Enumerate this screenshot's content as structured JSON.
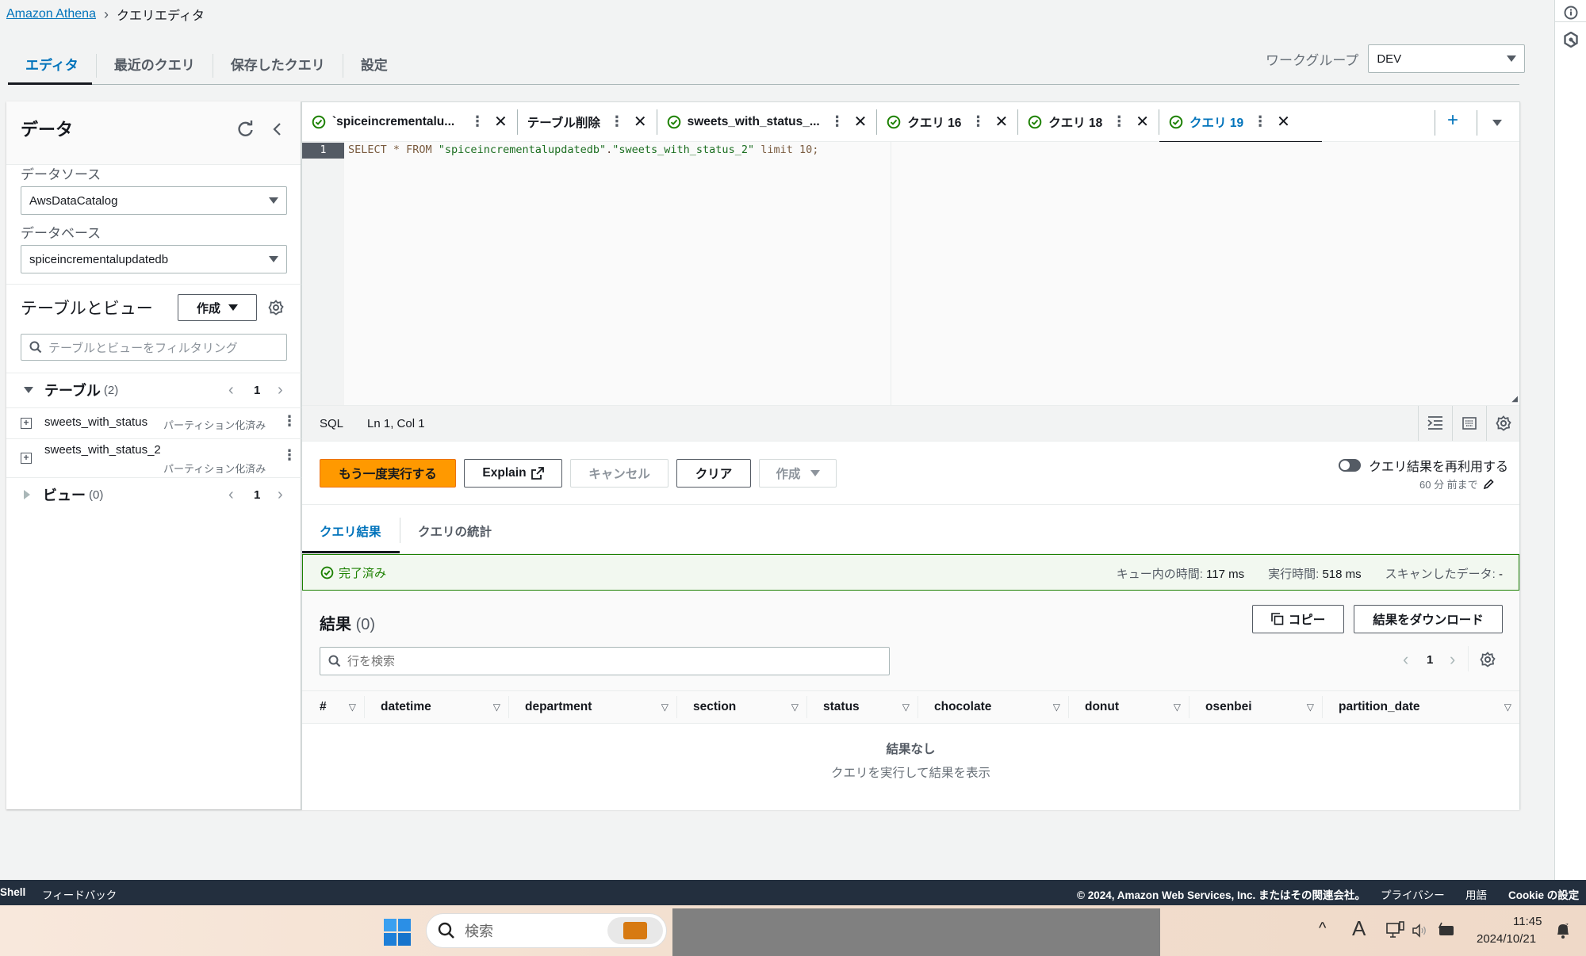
{
  "breadcrumb": {
    "root": "Amazon Athena",
    "current": "クエリエディタ"
  },
  "top_tabs": [
    {
      "label": "エディタ",
      "active": true
    },
    {
      "label": "最近のクエリ",
      "active": false
    },
    {
      "label": "保存したクエリ",
      "active": false
    },
    {
      "label": "設定",
      "active": false
    }
  ],
  "workgroup": {
    "label": "ワークグループ",
    "value": "DEV"
  },
  "left_panel": {
    "title": "データ",
    "datasource_label": "データソース",
    "datasource_value": "AwsDataCatalog",
    "database_label": "データベース",
    "database_value": "spiceincrementalupdatedb",
    "tables_views_title": "テーブルとビュー",
    "create_button": "作成",
    "filter_placeholder": "テーブルとビューをフィルタリング",
    "tables": {
      "label": "テーブル",
      "count": "(2)",
      "page": "1",
      "items": [
        {
          "name": "sweets_with_status",
          "tag": "パーティション化済み"
        },
        {
          "name": "sweets_with_status_2",
          "tag": "パーティション化済み"
        }
      ]
    },
    "views": {
      "label": "ビュー",
      "count": "(0)",
      "page": "1"
    }
  },
  "query_tabs": [
    {
      "label": "`spiceincrementalu...",
      "status": "success",
      "active": false
    },
    {
      "label": "テーブル削除",
      "status": "none",
      "active": false
    },
    {
      "label": "sweets_with_status_...",
      "status": "success",
      "active": false
    },
    {
      "label": "クエリ 16",
      "status": "success",
      "active": false
    },
    {
      "label": "クエリ 18",
      "status": "success",
      "active": false
    },
    {
      "label": "クエリ 19",
      "status": "success",
      "active": true
    }
  ],
  "editor": {
    "line_number": "1",
    "code": {
      "kw1": "SELECT * FROM ",
      "str1": "\"spiceincrementalupdatedb\"",
      "dot": ".",
      "str2": "\"sweets_with_status_2\"",
      "kw2": " limit 10;"
    },
    "language": "SQL",
    "cursor": "Ln 1, Col 1"
  },
  "actions": {
    "run_again": "もう一度実行する",
    "explain": "Explain",
    "cancel": "キャンセル",
    "clear": "クリア",
    "create": "作成",
    "reuse_label": "クエリ結果を再利用する",
    "reuse_enabled": false,
    "reuse_age": "60 分 前まで"
  },
  "results_tabs": [
    {
      "label": "クエリ結果",
      "active": true
    },
    {
      "label": "クエリの統計",
      "active": false
    }
  ],
  "status": {
    "text": "完了済み",
    "queue_label": "キュー内の時間:",
    "queue_value": "117 ms",
    "run_label": "実行時間:",
    "run_value": "518 ms",
    "scanned_label": "スキャンしたデータ:",
    "scanned_value": "-"
  },
  "results": {
    "title": "結果",
    "count": "(0)",
    "copy": "コピー",
    "download": "結果をダウンロード",
    "search_placeholder": "行を検索",
    "page": "1",
    "columns": [
      "#",
      "datetime",
      "department",
      "section",
      "status",
      "chocolate",
      "donut",
      "osenbei",
      "partition_date"
    ],
    "empty_title": "結果なし",
    "empty_subtitle": "クエリを実行して結果を表示"
  },
  "footer": {
    "cloudshell": "Shell",
    "feedback": "フィードバック",
    "copyright": "© 2024, Amazon Web Services, Inc. またはその関連会社。",
    "privacy": "プライバシー",
    "terms": "用語",
    "cookie": "Cookie の設定"
  },
  "taskbar": {
    "search_placeholder": "検索",
    "time": "11:45",
    "date": "2024/10/21",
    "ime": "A"
  }
}
